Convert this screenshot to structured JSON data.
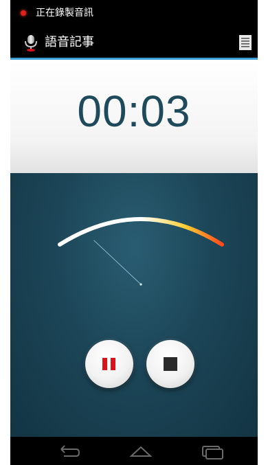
{
  "status_bar": {
    "notification_text": "正在錄製音訊",
    "recording_indicator_color": "#e0201a"
  },
  "action_bar": {
    "app_icon": "microphone-icon",
    "title": "語音記事",
    "menu_icon": "notes-list-icon"
  },
  "timer": {
    "elapsed": "00:03"
  },
  "level_meter": {
    "level": 0.05,
    "gradient_colors": [
      "#ffffff",
      "#ffcc33",
      "#ff4a1a"
    ]
  },
  "controls": {
    "pause_icon": "pause-icon",
    "pause_color": "#d8141a",
    "stop_icon": "stop-icon"
  },
  "nav_bar": {
    "back_icon": "back-icon",
    "home_icon": "home-icon",
    "recents_icon": "recents-icon"
  },
  "colors": {
    "accent": "#3aa0d8",
    "timer_text": "#1e4a5c",
    "background": "#1c4658"
  }
}
